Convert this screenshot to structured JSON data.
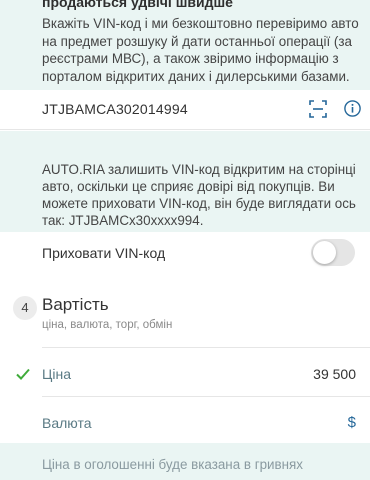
{
  "vin_section": {
    "heading": "продаються удвічі швидше",
    "description": "Вкажіть VIN-код і ми безкоштовно перевіримо авто на предмет розшуку й дати останньої операції (за реєстрами МВС), а також звіримо інформацію з порталом відкритих даних і дилерськими базами.",
    "vin_value": "JTJBAMCA302014994",
    "scan_icon": "scan-icon",
    "info_icon": "info-icon",
    "note": "AUTO.RIA залишить VIN-код відкритим на сторінці авто, оскільки це сприяє довірі від покупців. Ви можете приховати VIN-код, він буде виглядати ось так: JTJBAMCx30xxxx994.",
    "hide_label": "Приховати VIN-код",
    "hide_enabled": false
  },
  "price_section": {
    "step_number": "4",
    "title": "Вартість",
    "subtitle": "ціна, валюта, торг, обмін",
    "price_label": "Ціна",
    "price_value": "39 500",
    "price_status": "check-icon",
    "currency_label": "Валюта",
    "currency_value": "$",
    "note": "Ціна в оголошенні буде вказана в гривнях"
  },
  "colors": {
    "mint_bg": "#eaf5f3",
    "accent_blue": "#256799",
    "check_green": "#3fab3a"
  }
}
